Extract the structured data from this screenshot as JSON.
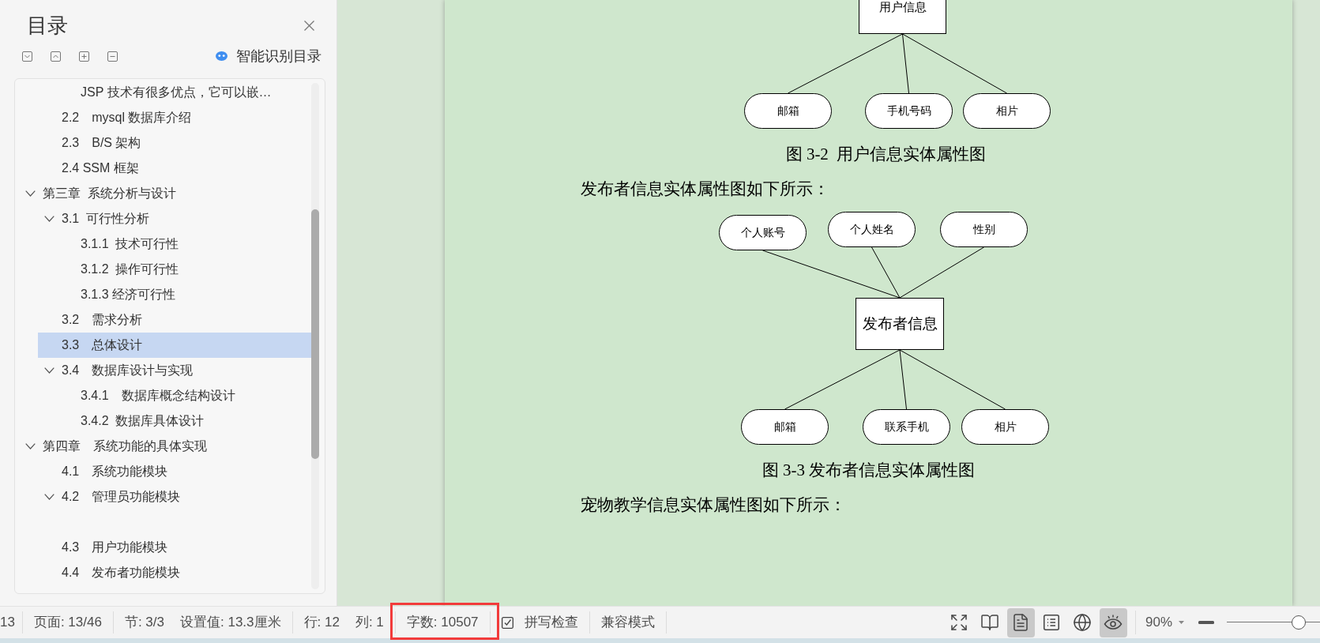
{
  "sidebar": {
    "title": "目录",
    "smart_toc_button": "智能识别目录",
    "toc": [
      {
        "expanded": true,
        "children": [
          {
            "expanded": true,
            "children": [
              {
                "label": "JSP 技术有很多优点，它可以嵌…",
                "selected": false
              }
            ]
          },
          {
            "label": "2.2　mysql 数据库介绍",
            "selected": false
          },
          {
            "label": "2.3　B/S 架构",
            "selected": false
          },
          {
            "label": "2.4 SSM 框架",
            "selected": false
          }
        ]
      },
      {
        "label": "第三章  系统分析与设计",
        "selected": false,
        "expanded": true,
        "children": [
          {
            "label": "3.1  可行性分析",
            "selected": false,
            "expanded": true,
            "children": [
              {
                "label": "3.1.1  技术可行性",
                "selected": false
              },
              {
                "label": "3.1.2  操作可行性",
                "selected": false
              },
              {
                "label": "3.1.3 经济可行性",
                "selected": false
              }
            ]
          },
          {
            "label": "3.2　需求分析",
            "selected": false
          },
          {
            "label": "3.3　总体设计",
            "selected": true
          },
          {
            "label": "3.4　数据库设计与实现",
            "selected": false,
            "expanded": true,
            "children": [
              {
                "label": "3.4.1　数据库概念结构设计",
                "selected": false
              },
              {
                "label": "3.4.2  数据库具体设计",
                "selected": false
              }
            ]
          }
        ]
      },
      {
        "label": "第四章　系统功能的具体实现",
        "selected": false,
        "expanded": true,
        "children": [
          {
            "label": "4.1　系统功能模块",
            "selected": false
          },
          {
            "label": "4.2　管理员功能模块",
            "selected": false,
            "expanded": true,
            "children": [
              {
                "selected": false
              }
            ]
          },
          {
            "label": "4.3　用户功能模块",
            "selected": false
          },
          {
            "label": "4.4　发布者功能模块",
            "selected": false
          }
        ]
      }
    ]
  },
  "page": {
    "figures": [
      {
        "entity": "用户信息",
        "lower_attributes": [
          "邮箱",
          "手机号码",
          "相片"
        ],
        "caption": "图 3-2  用户信息实体属性图",
        "text_after": "发布者信息实体属性图如下所示："
      },
      {
        "entity": "发布者信息",
        "upper_attributes": [
          "个人账号",
          "个人姓名",
          "性别"
        ],
        "lower_attributes": [
          "邮箱",
          "联系手机",
          "相片"
        ],
        "caption": "图 3-3 发布者信息实体属性图",
        "text_after": "宠物教学信息实体属性图如下所示："
      }
    ]
  },
  "status_bar": {
    "groups": [
      {
        "highlighted": false,
        "items": [
          {
            "kind": "info",
            "text": "13"
          }
        ]
      },
      {
        "highlighted": false,
        "items": [
          {
            "kind": "info",
            "text": "页面: 13/46"
          }
        ]
      },
      {
        "highlighted": false,
        "items": [
          {
            "kind": "info",
            "text": "节: 3/3"
          },
          {
            "kind": "info",
            "text": "设置值: 13.3厘米"
          }
        ]
      },
      {
        "highlighted": false,
        "items": [
          {
            "kind": "info",
            "text": "行: 12"
          },
          {
            "kind": "info",
            "text": "列: 1"
          }
        ]
      },
      {
        "highlighted": true,
        "items": [
          {
            "kind": "info",
            "text": "字数: 10507"
          }
        ]
      },
      {
        "highlighted": false,
        "items": [
          {
            "kind": "check-button",
            "text": "拼写检查"
          }
        ]
      },
      {
        "highlighted": false,
        "items": [
          {
            "kind": "button",
            "text": "兼容模式"
          }
        ]
      }
    ],
    "view_buttons": [
      {
        "selected": false
      },
      {
        "selected": false
      },
      {
        "selected": true
      },
      {
        "selected": false
      },
      {
        "selected": false
      },
      {
        "selected": true
      }
    ],
    "zoom": {
      "text": "90%",
      "level": 0.77
    }
  }
}
